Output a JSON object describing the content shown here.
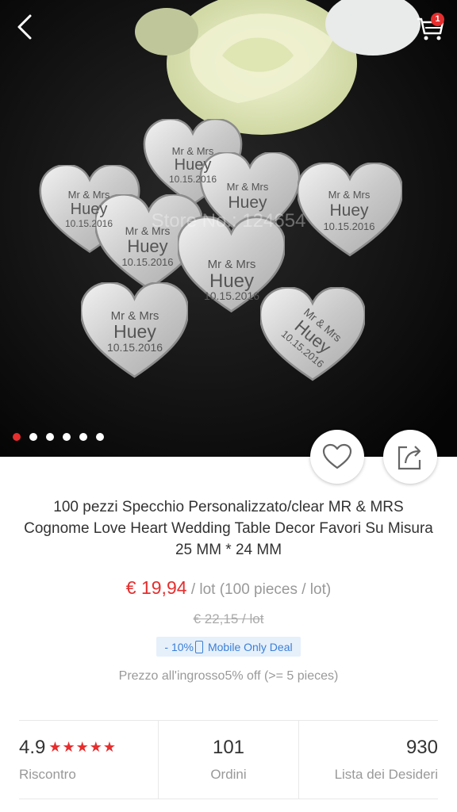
{
  "header": {
    "cart_count": "1"
  },
  "hero": {
    "watermark": "Store No.: 124654",
    "heart_line1": "Mr & Mrs",
    "heart_line2": "Huey",
    "heart_line3": "10.15.2016",
    "gallery_total": 6,
    "gallery_active": 1
  },
  "product": {
    "title": "100 pezzi Specchio Personalizzato/clear MR & MRS Cognome Love Heart Wedding Table Decor Favori Su Misura 25 MM * 24 MM",
    "price": "€ 19,94",
    "price_unit": " / lot (100 pieces / lot)",
    "old_price": "€ 22,15  / lot",
    "deal_discount": "- 10%",
    "deal_label": "Mobile Only Deal",
    "wholesale": "Prezzo all'ingrosso5% off (>= 5 pieces)"
  },
  "stats": {
    "rating": "4.9",
    "rating_stars": "★★★★★",
    "rating_label": "Riscontro",
    "orders": "101",
    "orders_label": "Ordini",
    "wishlist": "930",
    "wishlist_label": "Lista dei Desideri"
  },
  "colors": {
    "accent": "#e62e2e",
    "deal_blue": "#3b7fd6"
  }
}
